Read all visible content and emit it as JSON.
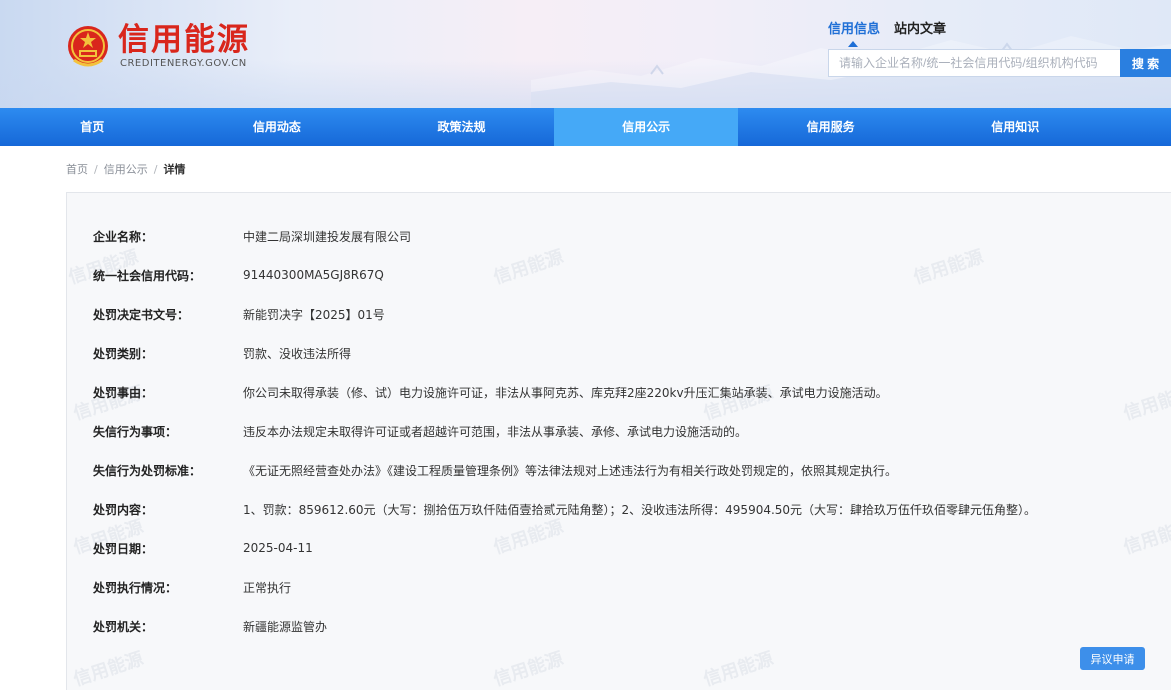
{
  "site": {
    "title": "信用能源",
    "subtitle": "CREDITENERGY.GOV.CN"
  },
  "search": {
    "tabs": [
      {
        "label": "信用信息",
        "active": true
      },
      {
        "label": "站内文章",
        "active": false
      }
    ],
    "placeholder": "请输入企业名称/统一社会信用代码/组织机构代码",
    "button": "搜 索"
  },
  "nav": {
    "items": [
      {
        "label": "首页",
        "active": false
      },
      {
        "label": "信用动态",
        "active": false
      },
      {
        "label": "政策法规",
        "active": false
      },
      {
        "label": "信用公示",
        "active": true
      },
      {
        "label": "信用服务",
        "active": false
      },
      {
        "label": "信用知识",
        "active": false
      }
    ]
  },
  "breadcrumb": {
    "items": [
      "首页",
      "信用公示"
    ],
    "current": "详情",
    "separator": "/"
  },
  "detail": {
    "watermark": "信用能源",
    "rows": [
      {
        "label": "企业名称：",
        "value": "中建二局深圳建投发展有限公司"
      },
      {
        "label": "统一社会信用代码：",
        "value": "91440300MA5GJ8R67Q"
      },
      {
        "label": "处罚决定书文号：",
        "value": "新能罚决字【2025】01号"
      },
      {
        "label": "处罚类别：",
        "value": "罚款、没收违法所得"
      },
      {
        "label": "处罚事由：",
        "value": "你公司未取得承装（修、试）电力设施许可证，非法从事阿克苏、库克拜2座220kv升压汇集站承装、承试电力设施活动。"
      },
      {
        "label": "失信行为事项：",
        "value": "违反本办法规定未取得许可证或者超越许可范围，非法从事承装、承修、承试电力设施活动的。"
      },
      {
        "label": "失信行为处罚标准：",
        "value": "《无证无照经营查处办法》《建设工程质量管理条例》等法律法规对上述违法行为有相关行政处罚规定的，依照其规定执行。"
      },
      {
        "label": "处罚内容：",
        "value": "1、罚款：859612.60元（大写：捌拾伍万玖仟陆佰壹拾贰元陆角整）；2、没收违法所得：495904.50元（大写：肆拾玖万伍仟玖佰零肆元伍角整）。"
      },
      {
        "label": "处罚日期：",
        "value": "2025-04-11"
      },
      {
        "label": "处罚执行情况：",
        "value": "正常执行"
      },
      {
        "label": "处罚机关：",
        "value": "新疆能源监管办"
      }
    ],
    "appeal_button": "异议申请"
  },
  "colors": {
    "brand_red": "#d9261c",
    "nav_blue": "#1f72e0",
    "nav_active": "#45a9f7",
    "accent_blue": "#2a7fe0"
  }
}
